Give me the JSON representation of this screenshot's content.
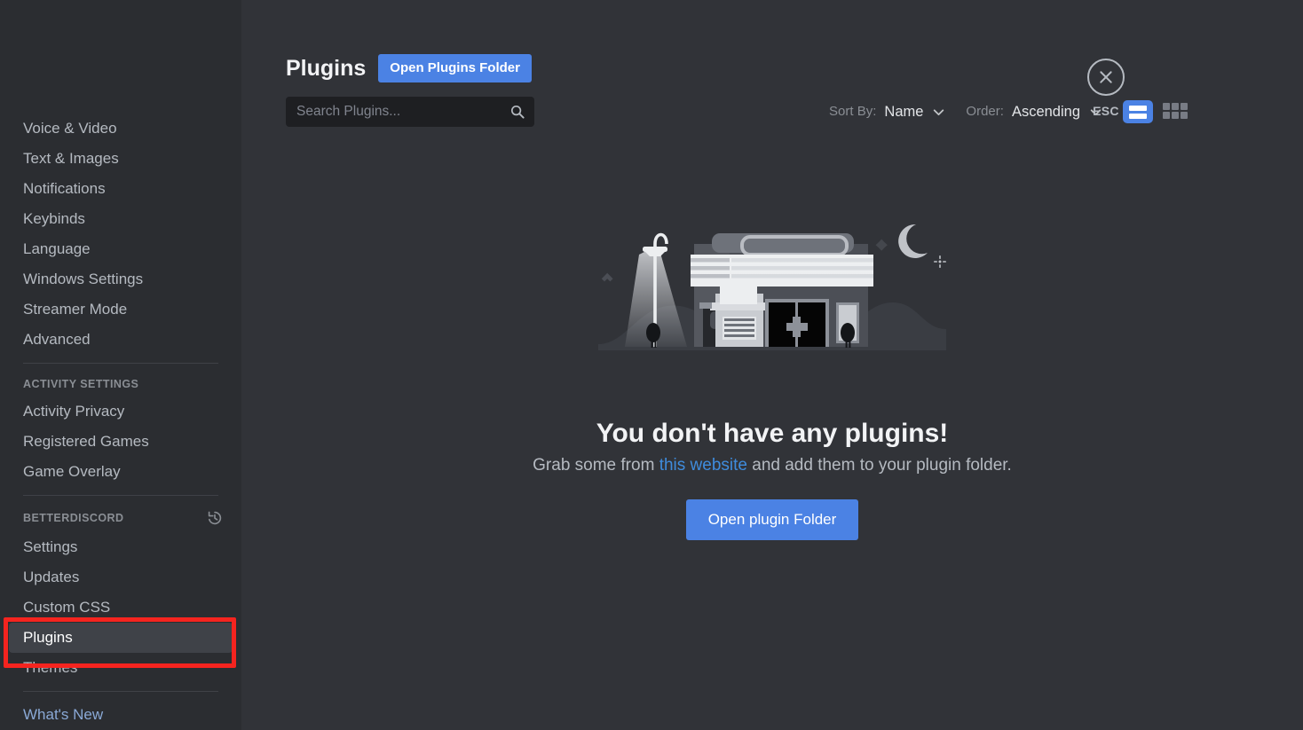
{
  "sidebar": {
    "items": [
      {
        "label": "Voice & Video",
        "type": "item",
        "name": "sidebar-item-voice-video"
      },
      {
        "label": "Text & Images",
        "type": "item",
        "name": "sidebar-item-text-images"
      },
      {
        "label": "Notifications",
        "type": "item",
        "name": "sidebar-item-notifications"
      },
      {
        "label": "Keybinds",
        "type": "item",
        "name": "sidebar-item-keybinds"
      },
      {
        "label": "Language",
        "type": "item",
        "name": "sidebar-item-language"
      },
      {
        "label": "Windows Settings",
        "type": "item",
        "name": "sidebar-item-windows-settings"
      },
      {
        "label": "Streamer Mode",
        "type": "item",
        "name": "sidebar-item-streamer-mode"
      },
      {
        "label": "Advanced",
        "type": "item",
        "name": "sidebar-item-advanced"
      },
      {
        "label": "",
        "type": "divider",
        "name": "sidebar-divider-1"
      },
      {
        "label": "ACTIVITY SETTINGS",
        "type": "header",
        "name": "sidebar-header-activity-settings"
      },
      {
        "label": "Activity Privacy",
        "type": "item",
        "name": "sidebar-item-activity-privacy"
      },
      {
        "label": "Registered Games",
        "type": "item",
        "name": "sidebar-item-registered-games"
      },
      {
        "label": "Game Overlay",
        "type": "item",
        "name": "sidebar-item-game-overlay"
      },
      {
        "label": "",
        "type": "divider",
        "name": "sidebar-divider-2"
      },
      {
        "label": "BETTERDISCORD",
        "type": "header-icon",
        "icon": "history-icon",
        "name": "sidebar-header-betterdiscord"
      },
      {
        "label": "Settings",
        "type": "item",
        "name": "sidebar-item-settings"
      },
      {
        "label": "Updates",
        "type": "item",
        "name": "sidebar-item-updates"
      },
      {
        "label": "Custom CSS",
        "type": "item",
        "name": "sidebar-item-custom-css"
      },
      {
        "label": "Plugins",
        "type": "item-selected",
        "name": "sidebar-item-plugins"
      },
      {
        "label": "Themes",
        "type": "item",
        "name": "sidebar-item-themes"
      },
      {
        "label": "",
        "type": "divider",
        "name": "sidebar-divider-3"
      },
      {
        "label": "What's New",
        "type": "link",
        "name": "sidebar-item-whats-new"
      }
    ]
  },
  "header": {
    "title": "Plugins",
    "open_folder_label": "Open Plugins Folder"
  },
  "search": {
    "placeholder": "Search Plugins...",
    "value": "",
    "icon": "search-icon"
  },
  "controls": {
    "sort_by_label": "Sort By:",
    "sort_by_value": "Name",
    "order_label": "Order:",
    "order_value": "Ascending",
    "list_view_icon": "list-view-icon",
    "grid_view_icon": "grid-view-icon",
    "active_view": "list"
  },
  "close": {
    "icon": "close-x-icon",
    "label": "ESC"
  },
  "empty_state": {
    "illustration": "closed-storefront-at-night-illustration",
    "title": "You don't have any plugins!",
    "text_before_link": "Grab some from ",
    "link_text": "this website",
    "text_after_link": " and add them to your plugin folder.",
    "button_label": "Open plugin Folder"
  },
  "annotation": {
    "highlight_color": "#f5241f",
    "target": "sidebar-item-plugins"
  },
  "colors": {
    "accent_blue": "#4b82e4",
    "link_blue": "#3f8cdd",
    "sidebar_bg": "#2b2d31",
    "main_bg": "#313338",
    "selected_bg": "#3f4248",
    "search_bg": "#1e1f22"
  }
}
